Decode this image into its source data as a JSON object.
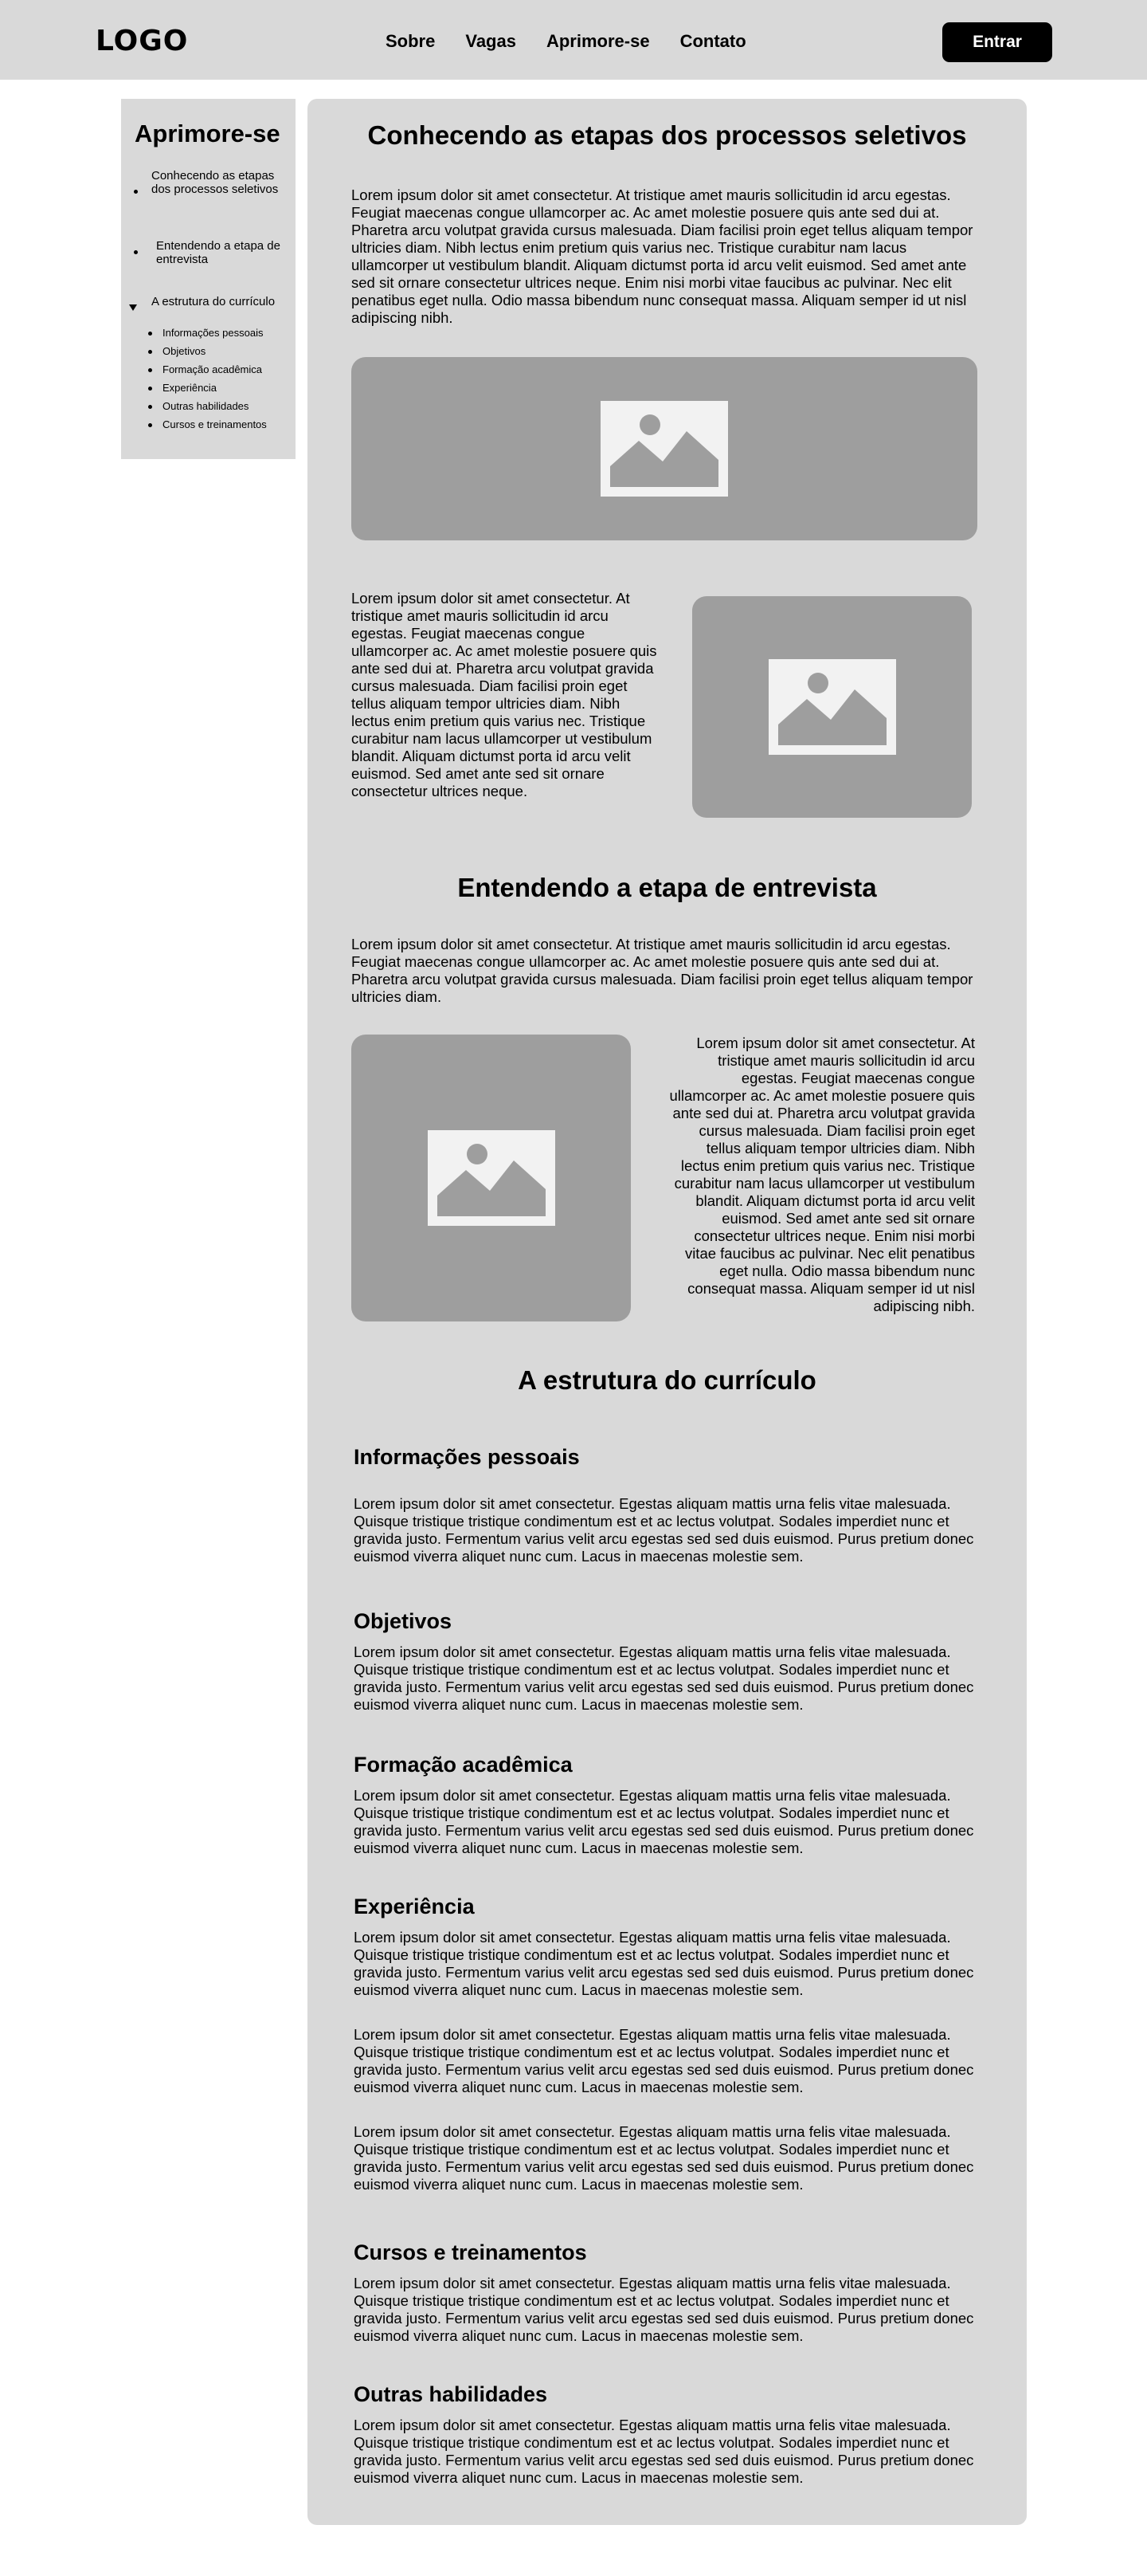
{
  "header": {
    "logo": "LOGO",
    "nav": [
      "Sobre",
      "Vagas",
      "Aprimore-se",
      "Contato"
    ],
    "login_label": "Entrar"
  },
  "sidebar": {
    "title": "Aprimore-se",
    "items": [
      "Conhecendo as etapas dos processos seletivos",
      "Entendendo  a etapa de entrevista",
      "A estrutura do currículo"
    ],
    "subitems": [
      "Informações pessoais",
      "Objetivos",
      "Formação acadêmica",
      "Experiência",
      "Outras habilidades",
      "Cursos e treinamentos"
    ]
  },
  "main": {
    "section1": {
      "title": "Conhecendo as etapas dos processos seletivos",
      "intro": "Lorem ipsum dolor sit amet consectetur. At tristique amet mauris sollicitudin id arcu egestas. Feugiat maecenas congue ullamcorper ac. Ac amet molestie posuere quis ante sed dui at. Pharetra arcu volutpat gravida cursus malesuada. Diam facilisi proin eget tellus aliquam tempor ultricies diam. Nibh lectus enim pretium quis varius nec. Tristique curabitur nam lacus ullamcorper ut vestibulum blandit. Aliquam dictumst porta id arcu velit euismod. Sed amet ante sed sit ornare consectetur ultrices neque. Enim nisi morbi vitae faucibus ac pulvinar. Nec elit penatibus eget nulla. Odio massa bibendum nunc consequat massa. Aliquam semper id ut nisl adipiscing nibh.",
      "side_text": "Lorem ipsum dolor sit amet consectetur. At tristique amet mauris sollicitudin id arcu egestas. Feugiat maecenas congue ullamcorper ac. Ac amet molestie posuere quis ante sed dui at. Pharetra arcu volutpat gravida cursus malesuada. Diam facilisi proin eget tellus aliquam tempor ultricies diam. Nibh lectus enim pretium quis varius nec. Tristique curabitur nam lacus ullamcorper ut vestibulum blandit. Aliquam dictumst porta id arcu velit euismod. Sed amet ante sed sit ornare consectetur ultrices neque."
    },
    "section2": {
      "title": "Entendendo  a etapa de entrevista",
      "intro": "Lorem ipsum dolor sit amet consectetur. At tristique amet mauris sollicitudin id arcu egestas. Feugiat maecenas congue ullamcorper ac. Ac amet molestie posuere quis ante sed dui at. Pharetra arcu volutpat gravida cursus malesuada. Diam facilisi proin eget tellus aliquam tempor ultricies diam.",
      "side_text": "Lorem ipsum dolor sit amet consectetur. At tristique amet mauris sollicitudin id arcu egestas. Feugiat maecenas congue ullamcorper ac. Ac amet molestie posuere quis ante sed dui at. Pharetra arcu volutpat gravida cursus malesuada. Diam facilisi proin eget tellus aliquam tempor ultricies diam. Nibh lectus enim pretium quis varius nec. Tristique curabitur nam lacus ullamcorper ut vestibulum blandit. Aliquam dictumst porta id arcu velit euismod. Sed amet ante sed sit ornare consectetur ultrices neque. Enim nisi morbi vitae faucibus ac pulvinar. Nec elit penatibus eget nulla. Odio massa bibendum nunc consequat massa. Aliquam semper id ut nisl adipiscing nibh."
    },
    "section3": {
      "title": "A estrutura do currículo",
      "lorem": "Lorem ipsum dolor sit amet consectetur. Egestas aliquam mattis urna felis vitae malesuada. Quisque tristique tristique condimentum est et ac lectus volutpat. Sodales imperdiet nunc et gravida justo. Fermentum varius velit arcu egestas sed sed duis euismod. Purus pretium donec euismod viverra aliquet nunc cum. Lacus in maecenas molestie sem.",
      "subsections": [
        "Informações pessoais",
        "Objetivos",
        "Formação acadêmica",
        "Experiência",
        "Cursos e treinamentos",
        "Outras habilidades"
      ]
    }
  }
}
